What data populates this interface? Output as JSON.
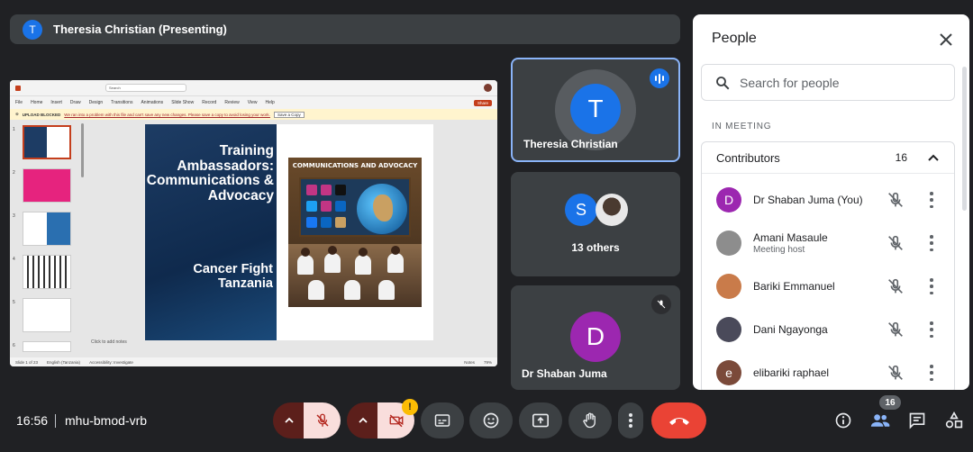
{
  "presenter": {
    "initial": "T",
    "label": "Theresia Christian (Presenting)"
  },
  "ppt": {
    "search_placeholder": "Search",
    "menu": [
      "File",
      "Home",
      "Insert",
      "Draw",
      "Design",
      "Transitions",
      "Animations",
      "Slide Show",
      "Record",
      "Review",
      "View",
      "Help"
    ],
    "share_label": "Share",
    "warning_label": "UPLOAD BLOCKED",
    "warning_msg": "We ran into a problem with this file and can't save any new changes. Please save a copy to avoid losing your work.",
    "save_copy_label": "Save a Copy",
    "thumb_numbers": [
      "1",
      "2",
      "3",
      "4",
      "5",
      "6"
    ],
    "notes_placeholder": "Click to add notes",
    "status_left": "Slide 1 of 23",
    "status_lang": "English (Tanzania)",
    "status_access": "Accessibility: Investigate",
    "status_notes": "Notes",
    "zoom": "79%"
  },
  "slide": {
    "title": "Training Ambassadors: Communications & Advocacy",
    "subtitle": "Cancer Fight Tanzania",
    "poster_title": "COMMUNICATIONS AND ADVOCACY"
  },
  "tiles": {
    "presenter": {
      "initial": "T",
      "name": "Theresia Christian"
    },
    "others": {
      "initial": "S",
      "label": "13 others"
    },
    "self": {
      "initial": "D",
      "name": "Dr Shaban Juma"
    }
  },
  "panel": {
    "title": "People",
    "search_placeholder": "Search for people",
    "section": "IN MEETING",
    "group_label": "Contributors",
    "group_count": "16",
    "people": [
      {
        "initial": "D",
        "name": "Dr Shaban Juma (You)",
        "role": "",
        "color": "#9c27b0"
      },
      {
        "initial": "",
        "name": "Amani Masaule",
        "role": "Meeting host",
        "color": "#8d8d8d"
      },
      {
        "initial": "",
        "name": "Bariki Emmanuel",
        "role": "",
        "color": "#c97b4a"
      },
      {
        "initial": "",
        "name": "Dani Ngayonga",
        "role": "",
        "color": "#4a4a5a"
      },
      {
        "initial": "e",
        "name": "elibariki raphael",
        "role": "",
        "color": "#7b4a3a"
      }
    ]
  },
  "bottom": {
    "time": "16:56",
    "meeting_code": "mhu-bmod-vrb",
    "warning_badge": "!",
    "people_count": "16"
  },
  "colors": {
    "accent": "#8ab4f8",
    "end_call": "#ea4335",
    "muted_bg": "#f9dedc"
  }
}
